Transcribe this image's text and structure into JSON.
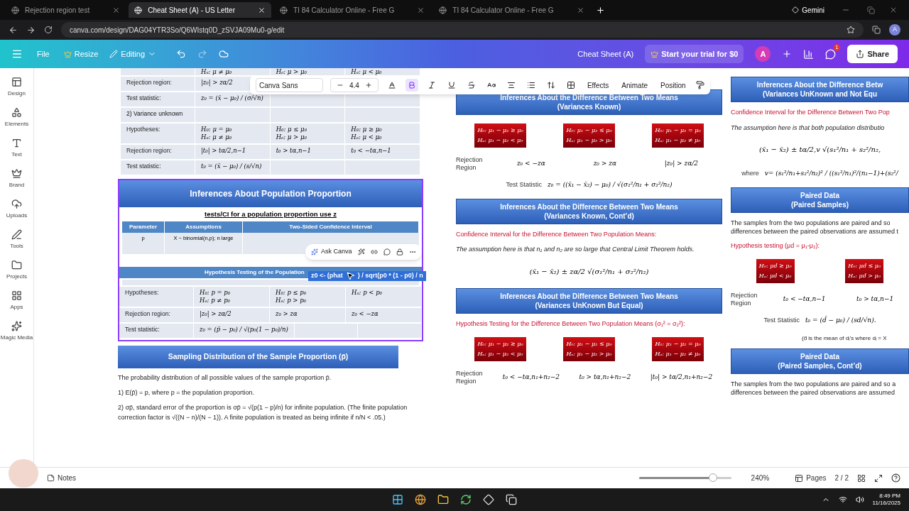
{
  "browser": {
    "tabs": [
      {
        "title": "Rejection region test",
        "selected": false
      },
      {
        "title": "Cheat Sheet (A) - US Letter",
        "selected": true
      },
      {
        "title": "TI 84 Calculator Online - Free G",
        "selected": false
      },
      {
        "title": "TI 84 Calculator Online - Free G",
        "selected": false
      }
    ],
    "gemini": "Gemini",
    "url": "canva.com/design/DAG04YTR3So/Q6WIstq0D_zSVJA09Mu0-g/edit",
    "profile": "A"
  },
  "editor_bar": {
    "file": "File",
    "resize": "Resize",
    "mode": "Editing",
    "title": "Cheat Sheet (A)",
    "trial": "Start your trial for $0",
    "avatar": "A",
    "badge": "1",
    "share": "Share"
  },
  "sidebar": [
    {
      "label": "Design",
      "kind": "design"
    },
    {
      "label": "Elements",
      "kind": "elements"
    },
    {
      "label": "Text",
      "kind": "text"
    },
    {
      "label": "Brand",
      "kind": "brand"
    },
    {
      "label": "Uploads",
      "kind": "uploads"
    },
    {
      "label": "Tools",
      "kind": "tools"
    },
    {
      "label": "Projects",
      "kind": "projects"
    },
    {
      "label": "Apps",
      "kind": "apps"
    },
    {
      "label": "Magic Media",
      "kind": "magic"
    }
  ],
  "text_toolbar": {
    "font": "Canva Sans",
    "size": "4.4",
    "formats": [
      {
        "kind": "color",
        "on": false
      },
      {
        "kind": "bold",
        "on": true
      },
      {
        "kind": "italic",
        "on": false
      },
      {
        "kind": "underline",
        "on": false
      },
      {
        "kind": "strike",
        "on": false
      },
      {
        "kind": "case",
        "on": false
      },
      {
        "kind": "align",
        "on": false
      },
      {
        "kind": "list",
        "on": false
      },
      {
        "kind": "spacing",
        "on": false
      },
      {
        "kind": "transparency",
        "on": false
      }
    ],
    "actions": [
      "Effects",
      "Animate",
      "Position"
    ]
  },
  "ask_canva": "Ask Canva",
  "selected_text": [
    "z0 <- (phat",
    ") / sqrt(p0 * (1 - p0) / n"
  ],
  "column_1": {
    "mean_table": [
      {
        "kind": "row",
        "cells": [
          [],
          [
            "Hₐ: μ ≠ μ₀"
          ],
          [
            "Hₐ: μ > μ₀"
          ],
          [
            "Hₐ: μ < μ₀"
          ]
        ]
      },
      {
        "kind": "row",
        "cells": [
          [
            "Rejection region:"
          ],
          [
            "|z₀| > zα/2"
          ]
        ]
      },
      {
        "kind": "row",
        "cells": [
          [
            "Test statistic:"
          ],
          [
            "z₀ = (x̄ − μ₀) / (σ/√n)"
          ]
        ]
      },
      {
        "kind": "heading",
        "cells": [
          [
            "2) Variance unknown"
          ]
        ]
      },
      {
        "kind": "row",
        "cells": [
          [
            "Hypotheses:"
          ],
          [
            "H₀: μ = μ₀",
            "Hₐ: μ ≠ μ₀"
          ],
          [
            "H₀: μ ≤ μ₀",
            "Hₐ: μ > μ₀"
          ],
          [
            "H₀: μ ≥ μ₀",
            "Hₐ: μ < μ₀"
          ]
        ]
      },
      {
        "kind": "row",
        "cells": [
          [
            "Rejection region:"
          ],
          [
            "|t₀| > tα/2,n−1"
          ],
          [
            "t₀ > tα,n−1"
          ],
          [
            "t₀ < −tα,n−1"
          ]
        ]
      },
      {
        "kind": "row",
        "cells": [
          [
            "Test statistic:"
          ],
          [
            "t₀ = (x̄ − μ₀) / (s/√n)"
          ]
        ]
      }
    ],
    "proportion": {
      "title": "Inferences About Population Proportion",
      "subtitle": "tests/CI for a population proportion use z",
      "ci_table": {
        "headers": [
          "Parameter",
          "Assumptions",
          "Two-Sided Confidence Interval"
        ],
        "values": [
          "p",
          "X ~ binomial(n,p); n large"
        ]
      },
      "test_header": "Hypothesis Testing of the Population",
      "test_rows": [
        {
          "label": "Hypotheses:",
          "cells": [
            [
              "H₀: p = p₀",
              "Hₐ: p ≠ p₀"
            ],
            [
              "H₀: p ≤ p₀",
              "Hₐ: p > p₀"
            ],
            [
              "Hₐ: p < p₀"
            ]
          ]
        },
        {
          "label": "Rejection region:",
          "cells": [
            [
              "|z₀| > zα/2"
            ],
            [
              "z₀ > zα"
            ],
            [
              "z₀ < −zα"
            ]
          ]
        },
        {
          "label": "Test statistic:",
          "cells": [
            [
              "z₀ = (p̄ − p₀) / √(p₀(1 − p₀)/n)"
            ]
          ]
        }
      ]
    },
    "sampling": {
      "title": "Sampling Distribution of the Sample Proportion (p̄)",
      "paragraphs": [
        "The probability distribution of all possible values of the sample proportion p̄.",
        "1)  E(p̄) = p, where p = the population proportion.",
        "2) σp̄, standard error of the proportion is σp̄ = √(p(1 − p)/n) for infinite population. (The finite population correction factor is √((N − n)/(N − 1)). A finite population is treated as being infinite if n/N < .05.)"
      ]
    }
  },
  "column_2": [
    {
      "kind": "header",
      "lines": [
        "Inferences About the Difference Between Two Means",
        "(Variances Known)"
      ]
    },
    {
      "kind": "boxes",
      "boxes": [
        [
          "H₀: μ₁ − μ₂ ≥ μ₀",
          "Hₐ: μ₁ − μ₂ < μ₀"
        ],
        [
          "H₀: μ₁ − μ₂ ≤ μ₀",
          "Hₐ: μ₁ − μ₂ > μ₀"
        ],
        [
          "H₀: μ₁ − μ₂ = μ₀",
          "Hₐ: μ₁ − μ₂ ≠ μ₀"
        ]
      ]
    },
    {
      "kind": "rejection",
      "label": "Rejection Region",
      "values": [
        "z₀ < −zα",
        "z₀ > zα",
        "|z₀| > zα/2"
      ]
    },
    {
      "kind": "statistic",
      "label": "Test Statistic",
      "formula": "z₀ = ((x̄₁ − x̄₂) − μ₀) / √(σ₁²/n₁ + σ₂²/n₂)"
    },
    {
      "kind": "header",
      "lines": [
        "Inferences About the Difference Between Two Means",
        "(Variances Known, Cont’d)"
      ]
    },
    {
      "kind": "red",
      "text": "Confidence Interval for the Difference Between Two Population Means:"
    },
    {
      "kind": "italic",
      "text": "The assumption here is that n₁ and n₂ are so large that Central Limit Theorem holds."
    },
    {
      "kind": "formula",
      "text": "(x̄₁ − x̄₂) ± zα/2 √(σ₁²/n₁ + σ₂²/n₂)"
    },
    {
      "kind": "header",
      "lines": [
        "Inferences About the Difference Between Two Means",
        "(Variances UnKnown But Equal)"
      ]
    },
    {
      "kind": "red",
      "text": "Hypothesis Testing for the Difference Between Two Population Means (σ₁² = σ₂²):"
    },
    {
      "kind": "boxes",
      "boxes": [
        [
          "H₀: μ₁ − μ₂ ≥ μ₀",
          "Hₐ: μ₁ − μ₂ < μ₀"
        ],
        [
          "H₀: μ₁ − μ₂ ≤ μ₀",
          "Hₐ: μ₁ − μ₂ > μ₀"
        ],
        [
          "H₀: μ₁ − μ₂ = μ₀",
          "Hₐ: μ₁ − μ₂ ≠ μ₀"
        ]
      ]
    },
    {
      "kind": "rejection",
      "label": "Rejection Region",
      "values": [
        "t₀ < −tα,n₁+n₂−2",
        "t₀ > tα,n₁+n₂−2",
        "|t₀| > tα/2,n₁+n₂−2"
      ]
    }
  ],
  "column_3": [
    {
      "kind": "header",
      "lines": [
        "Inferences About the Difference Betw",
        "(Variances UnKnown and Not Equ"
      ]
    },
    {
      "kind": "red",
      "text": "Confidence Interval for the Difference Between Two Pop"
    },
    {
      "kind": "italic",
      "text": "The assumption here is that both population distributio"
    },
    {
      "kind": "formula",
      "text": "(x̄₁ − x̄₂) ± tα/2,v √(s₁²/n₁ + s₂²/n₂,"
    },
    {
      "kind": "statistic",
      "label": "where",
      "formula": "v= (s₁²/n₁+s₂²/n₂)² / ((s₁²/n₁)²/(n₁−1)+(s₂²/"
    },
    {
      "kind": "header",
      "lines": [
        "Paired Data",
        "(Paired Samples)"
      ]
    },
    {
      "kind": "paragraph",
      "text": "The samples from the two populations are paired and so differences between the paired observations are assumed t"
    },
    {
      "kind": "red",
      "text": "Hypothesis testing (μd = μ₁-μ₂):"
    },
    {
      "kind": "boxes",
      "boxes": [
        [
          "H₀: μd ≥ μ₀",
          "Hₐ: μd < μ₀"
        ],
        [
          "H₀: μd ≤ μ₀",
          "Hₐ: μd > μ₀"
        ]
      ]
    },
    {
      "kind": "rejection",
      "label": "Rejection Region",
      "values": [
        "t₀ < −tα,n−1",
        "t₀ > tα,n−1"
      ]
    },
    {
      "kind": "statistic",
      "label": "Test Statistic",
      "formula": "t₀ = (d̄ − μ₀) / (sd/√n)."
    },
    {
      "kind": "note",
      "text": "(d̄ is the mean of dᵢ’s  where dᵢ = X"
    },
    {
      "kind": "header",
      "lines": [
        "Paired Data",
        "(Paired Samples, Cont’d)"
      ]
    },
    {
      "kind": "paragraph",
      "text": "The samples from the two populations are paired and so a differences between the paired observations are assumed"
    }
  ],
  "bottom_bar": {
    "notes": "Notes",
    "level": 0.8,
    "zoom": "240%",
    "pages": "Pages",
    "page_count": "2 / 2"
  },
  "taskbar": {
    "time": "8:49 PM",
    "date": "11/16/2025"
  }
}
